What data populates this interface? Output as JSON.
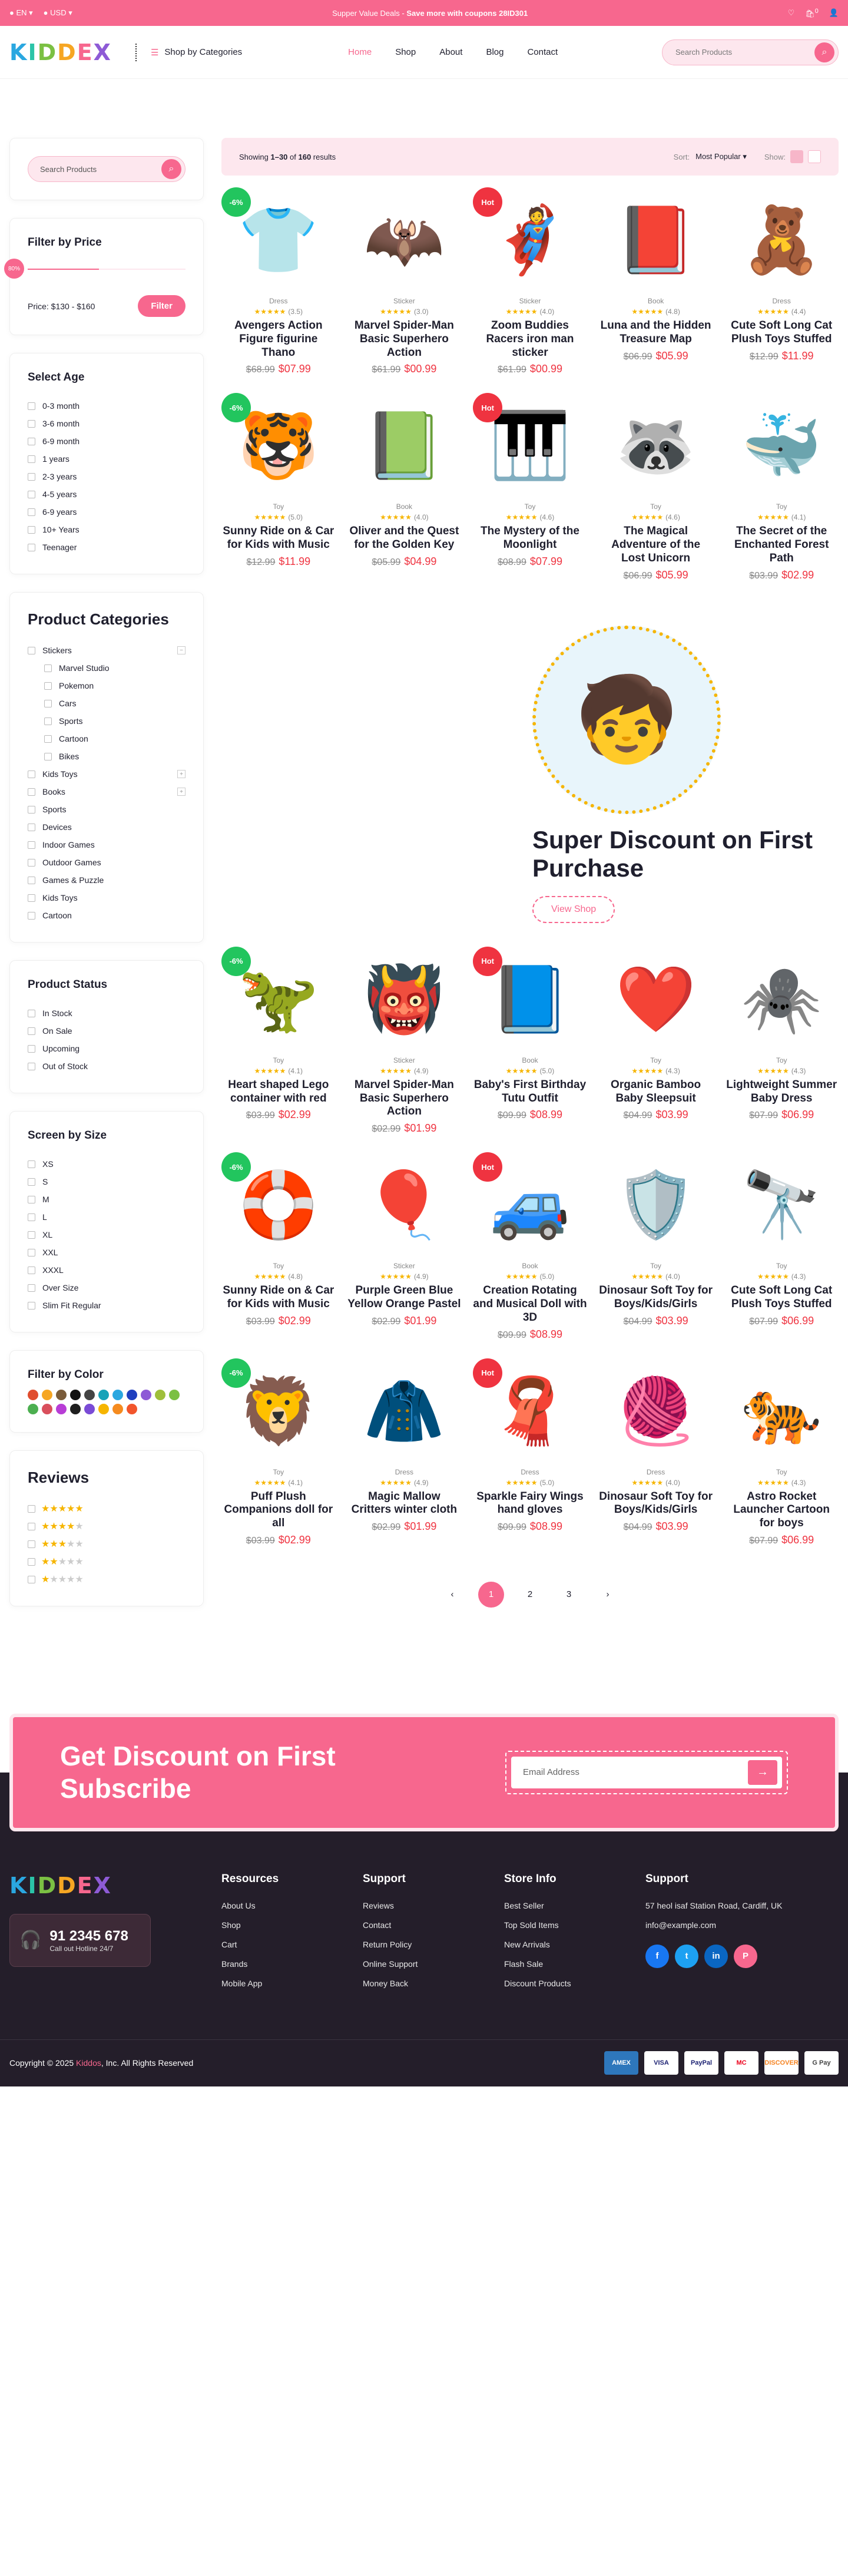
{
  "topbar": {
    "language": "EN",
    "currency": "USD",
    "promo_prefix": "Supper Value Deals - ",
    "promo_bold": "Save more with coupons 28ID301",
    "cart_count": "0"
  },
  "header": {
    "logo_letters": [
      "K",
      "I",
      "D",
      "D",
      "E",
      "X"
    ],
    "categories_label": "Shop by Categories",
    "nav": [
      "Home",
      "Shop",
      "About",
      "Blog",
      "Contact"
    ],
    "search_placeholder": "Search Products"
  },
  "sidebar": {
    "search_placeholder": "Search Products",
    "price_title": "Filter by Price",
    "price_knob": "80%",
    "price_fill_fraction": 0.45,
    "price_range": "Price: $130 - $160",
    "filter_label": "Filter",
    "age_title": "Select Age",
    "ages": [
      "0-3 month",
      "3-6 month",
      "6-9 month",
      "1 years",
      "2-3 years",
      "4-5 years",
      "6-9 years",
      "10+ Years",
      "Teenager"
    ],
    "categories_title": "Product Categories",
    "categories": [
      {
        "label": "Stickers",
        "sub": false,
        "expand": "−"
      },
      {
        "label": "Marvel Studio",
        "sub": true
      },
      {
        "label": "Pokemon",
        "sub": true
      },
      {
        "label": "Cars",
        "sub": true
      },
      {
        "label": "Sports",
        "sub": true
      },
      {
        "label": "Cartoon",
        "sub": true
      },
      {
        "label": "Bikes",
        "sub": true
      },
      {
        "label": "Kids Toys",
        "sub": false,
        "expand": "+"
      },
      {
        "label": "Books",
        "sub": false,
        "expand": "+"
      },
      {
        "label": "Sports",
        "sub": false
      },
      {
        "label": "Devices",
        "sub": false
      },
      {
        "label": "Indoor Games",
        "sub": false
      },
      {
        "label": "Outdoor Games",
        "sub": false
      },
      {
        "label": "Games & Puzzle",
        "sub": false
      },
      {
        "label": "Kids Toys",
        "sub": false
      },
      {
        "label": "Cartoon",
        "sub": false
      }
    ],
    "status_title": "Product Status",
    "statuses": [
      "In Stock",
      "On Sale",
      "Upcoming",
      "Out of Stock"
    ],
    "size_title": "Screen by Size",
    "sizes": [
      "XS",
      "S",
      "M",
      "L",
      "XL",
      "XXL",
      "XXXL",
      "Over Size",
      "Slim Fit Regular"
    ],
    "color_title": "Filter by Color",
    "colors": [
      "#e04d2e",
      "#f6a623",
      "#7a5c3a",
      "#111111",
      "#444444",
      "#17a2b8",
      "#2aa7e0",
      "#1f3fbf",
      "#8e5bd6",
      "#9fbf3b",
      "#7bc043",
      "#4caf50",
      "#d94f5c",
      "#b83dd6",
      "#1f1f1f",
      "#7a4bd6",
      "#f6b500",
      "#f58b1f",
      "#f2552c"
    ],
    "reviews_title": "Reviews",
    "reviews": [
      5,
      4,
      3,
      2,
      1
    ]
  },
  "toolbar": {
    "showing_prefix": "Showing ",
    "showing_range": "1–30",
    "showing_mid": " of ",
    "showing_total": "160",
    "showing_suffix": " results",
    "sort_label": "Sort:",
    "sort_value": "Most Popular",
    "show_label": "Show:"
  },
  "products_top": [
    {
      "badge": "-6%",
      "badge_type": "sale",
      "icon": "👕",
      "category": "Dress",
      "reviews": "(3.5)",
      "title": "Avengers Action Figure figurine Thano",
      "old": "$68.99",
      "price": "$07.99"
    },
    {
      "badge": "",
      "badge_type": "",
      "icon": "🦇",
      "category": "Sticker",
      "reviews": "(3.0)",
      "title": "Marvel Spider-Man Basic Superhero Action",
      "old": "$61.99",
      "price": "$00.99"
    },
    {
      "badge": "Hot",
      "badge_type": "hot",
      "icon": "🦸",
      "category": "Sticker",
      "reviews": "(4.0)",
      "title": "Zoom Buddies Racers iron man sticker",
      "old": "$61.99",
      "price": "$00.99"
    },
    {
      "badge": "",
      "badge_type": "",
      "icon": "📕",
      "category": "Book",
      "reviews": "(4.8)",
      "title": "Luna and the Hidden Treasure Map",
      "old": "$06.99",
      "price": "$05.99"
    },
    {
      "badge": "",
      "badge_type": "",
      "icon": "🧸",
      "category": "Dress",
      "reviews": "(4.4)",
      "title": "Cute Soft Long Cat Plush Toys Stuffed",
      "old": "$12.99",
      "price": "$11.99"
    },
    {
      "badge": "-6%",
      "badge_type": "sale",
      "icon": "🐯",
      "category": "Toy",
      "reviews": "(5.0)",
      "title": "Sunny Ride on & Car for Kids with Music",
      "old": "$12.99",
      "price": "$11.99"
    },
    {
      "badge": "",
      "badge_type": "",
      "icon": "📗",
      "category": "Book",
      "reviews": "(4.0)",
      "title": "Oliver and the Quest for the Golden Key",
      "old": "$05.99",
      "price": "$04.99"
    },
    {
      "badge": "Hot",
      "badge_type": "hot",
      "icon": "🎹",
      "category": "Toy",
      "reviews": "(4.6)",
      "title": "The Mystery of the Moonlight",
      "old": "$08.99",
      "price": "$07.99"
    },
    {
      "badge": "",
      "badge_type": "",
      "icon": "🦝",
      "category": "Toy",
      "reviews": "(4.6)",
      "title": "The Magical Adventure of the Lost Unicorn",
      "old": "$06.99",
      "price": "$05.99"
    },
    {
      "badge": "",
      "badge_type": "",
      "icon": "🐳",
      "category": "Toy",
      "reviews": "(4.1)",
      "title": "The Secret of the Enchanted Forest Path",
      "old": "$03.99",
      "price": "$02.99"
    }
  ],
  "banner": {
    "title": "Super Discount on First Purchase",
    "button": "View Shop"
  },
  "products_bottom": [
    {
      "badge": "-6%",
      "badge_type": "sale",
      "icon": "🦖",
      "category": "Toy",
      "reviews": "(4.1)",
      "title": "Heart shaped Lego container with red",
      "old": "$03.99",
      "price": "$02.99"
    },
    {
      "badge": "",
      "badge_type": "",
      "icon": "👹",
      "category": "Sticker",
      "reviews": "(4.9)",
      "title": "Marvel Spider-Man Basic Superhero Action",
      "old": "$02.99",
      "price": "$01.99"
    },
    {
      "badge": "Hot",
      "badge_type": "hot",
      "icon": "📘",
      "category": "Book",
      "reviews": "(5.0)",
      "title": "Baby's First Birthday Tutu Outfit",
      "old": "$09.99",
      "price": "$08.99"
    },
    {
      "badge": "",
      "badge_type": "",
      "icon": "❤️",
      "category": "Toy",
      "reviews": "(4.3)",
      "title": "Organic Bamboo Baby Sleepsuit",
      "old": "$04.99",
      "price": "$03.99"
    },
    {
      "badge": "",
      "badge_type": "",
      "icon": "🕷️",
      "category": "Toy",
      "reviews": "(4.3)",
      "title": "Lightweight Summer Baby Dress",
      "old": "$07.99",
      "price": "$06.99"
    },
    {
      "badge": "-6%",
      "badge_type": "sale",
      "icon": "🛟",
      "category": "Toy",
      "reviews": "(4.8)",
      "title": "Sunny Ride on & Car for Kids with Music",
      "old": "$03.99",
      "price": "$02.99"
    },
    {
      "badge": "",
      "badge_type": "",
      "icon": "🎈",
      "category": "Sticker",
      "reviews": "(4.9)",
      "title": "Purple Green Blue Yellow Orange Pastel",
      "old": "$02.99",
      "price": "$01.99"
    },
    {
      "badge": "Hot",
      "badge_type": "hot",
      "icon": "🚙",
      "category": "Book",
      "reviews": "(5.0)",
      "title": "Creation Rotating and Musical Doll with 3D",
      "old": "$09.99",
      "price": "$08.99"
    },
    {
      "badge": "",
      "badge_type": "",
      "icon": "🛡️",
      "category": "Toy",
      "reviews": "(4.0)",
      "title": "Dinosaur Soft Toy for Boys/Kids/Girls",
      "old": "$04.99",
      "price": "$03.99"
    },
    {
      "badge": "",
      "badge_type": "",
      "icon": "🔭",
      "category": "Toy",
      "reviews": "(4.3)",
      "title": "Cute Soft Long Cat Plush Toys Stuffed",
      "old": "$07.99",
      "price": "$06.99"
    },
    {
      "badge": "-6%",
      "badge_type": "sale",
      "icon": "🦁",
      "category": "Toy",
      "reviews": "(4.1)",
      "title": "Puff Plush Companions doll for all",
      "old": "$03.99",
      "price": "$02.99"
    },
    {
      "badge": "",
      "badge_type": "",
      "icon": "🧥",
      "category": "Dress",
      "reviews": "(4.9)",
      "title": "Magic Mallow Critters winter cloth",
      "old": "$02.99",
      "price": "$01.99"
    },
    {
      "badge": "Hot",
      "badge_type": "hot",
      "icon": "🧣",
      "category": "Dress",
      "reviews": "(5.0)",
      "title": "Sparkle Fairy Wings hand gloves",
      "old": "$09.99",
      "price": "$08.99"
    },
    {
      "badge": "",
      "badge_type": "",
      "icon": "🧶",
      "category": "Dress",
      "reviews": "(4.0)",
      "title": "Dinosaur Soft Toy for Boys/Kids/Girls",
      "old": "$04.99",
      "price": "$03.99"
    },
    {
      "badge": "",
      "badge_type": "",
      "icon": "🐅",
      "category": "Toy",
      "reviews": "(4.3)",
      "title": "Astro Rocket Launcher Cartoon for boys",
      "old": "$07.99",
      "price": "$06.99"
    }
  ],
  "pagination": [
    "1",
    "2",
    "3"
  ],
  "subscribe": {
    "title": "Get Discount on First Subscribe",
    "placeholder": "Email Address"
  },
  "footer": {
    "hotline_number": "91 2345 678",
    "hotline_label": "Call out Hotline 24/7",
    "resources_title": "Resources",
    "resources": [
      "About Us",
      "Shop",
      "Cart",
      "Brands",
      "Mobile App"
    ],
    "support_title": "Support",
    "support": [
      "Reviews",
      "Contact",
      "Return Policy",
      "Online Support",
      "Money Back"
    ],
    "store_title": "Store Info",
    "store": [
      "Best Seller",
      "Top Sold Items",
      "New Arrivals",
      "Flash Sale",
      "Discount Products"
    ],
    "contact_title": "Support",
    "address": "57 heol isaf Station Road, Cardiff, UK",
    "email": "info@example.com",
    "social": [
      "f",
      "t",
      "in",
      "P"
    ],
    "copyright_prefix": "Copyright © 2025 ",
    "copyright_brand": "Kiddos",
    "copyright_suffix": ", Inc. All Rights Reserved",
    "payments": [
      "AMEX",
      "VISA",
      "PayPal",
      "MC",
      "DISCOVER",
      "G Pay"
    ]
  }
}
